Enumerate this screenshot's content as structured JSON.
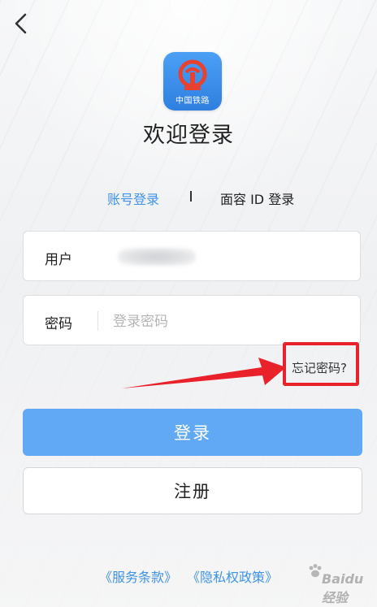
{
  "app": {
    "logo_text": "中国铁路",
    "title": "欢迎登录"
  },
  "tabs": {
    "account": "账号登录",
    "face": "面容 ID 登录"
  },
  "form": {
    "user_label": "用户",
    "password_label": "密码",
    "password_placeholder": "登录密码",
    "forgot": "忘记密码?"
  },
  "buttons": {
    "login": "登录",
    "register": "注册"
  },
  "footer": {
    "terms": "《服务条款》",
    "privacy": "《隐私权政策》"
  },
  "watermark": {
    "text": "Baidu 经验"
  },
  "colors": {
    "accent": "#3f93ec",
    "login_button": "#62a9f5",
    "highlight": "#e8212a"
  },
  "icons": {
    "back": "chevron-left-icon",
    "logo": "railway-emblem-icon",
    "arrow": "red-arrow-annotation"
  }
}
